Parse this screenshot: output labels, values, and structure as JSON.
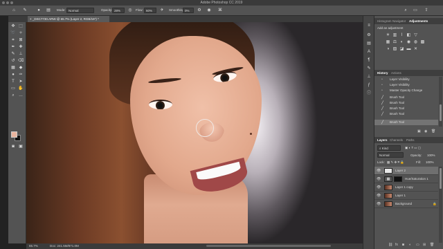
{
  "window": {
    "title": "Adobe Photoshop CC 2019"
  },
  "options_bar": {
    "mode_label": "Mode:",
    "mode_value": "Normal",
    "opacity_label": "Opacity:",
    "opacity_value": "28%",
    "flow_label": "Flow:",
    "flow_value": "60%",
    "smoothing_label": "Smoothing:",
    "smoothing_value": "0%"
  },
  "document_tab": {
    "label": "_DSC7730.ARW @ 65.7% (Layer 2, RGB/16*) *"
  },
  "status": {
    "zoom": "65.7%",
    "doc": "Doc: 241.5M/871.0M"
  },
  "colors": {
    "foreground": "#e8b49f",
    "background": "#111111"
  },
  "top_panel": {
    "tabs": [
      "Histogram",
      "Navigator",
      "Adjustments"
    ],
    "add_label": "Add an adjustment"
  },
  "history": {
    "tabs": [
      "History",
      "Actions"
    ],
    "items": [
      "Layer Visibility",
      "Layer Visibility",
      "Master Opacity Change",
      "Brush Tool",
      "Brush Tool",
      "Brush Tool",
      "Brush Tool",
      "Brush Tool"
    ]
  },
  "layers": {
    "tabs": [
      "Layers",
      "Channels",
      "Paths"
    ],
    "filter_label": "Kind",
    "blend_mode": "Normal",
    "opacity_label": "Opacity:",
    "opacity_value": "100%",
    "lock_label": "Lock:",
    "fill_label": "Fill:",
    "fill_value": "100%",
    "rows": [
      {
        "name": "Layer 2",
        "selected": true
      },
      {
        "name": "Hue/Saturation 1",
        "selected": false
      },
      {
        "name": "Layer 1 copy",
        "selected": false
      },
      {
        "name": "Layer 1",
        "selected": false
      },
      {
        "name": "Background",
        "selected": false
      }
    ]
  }
}
